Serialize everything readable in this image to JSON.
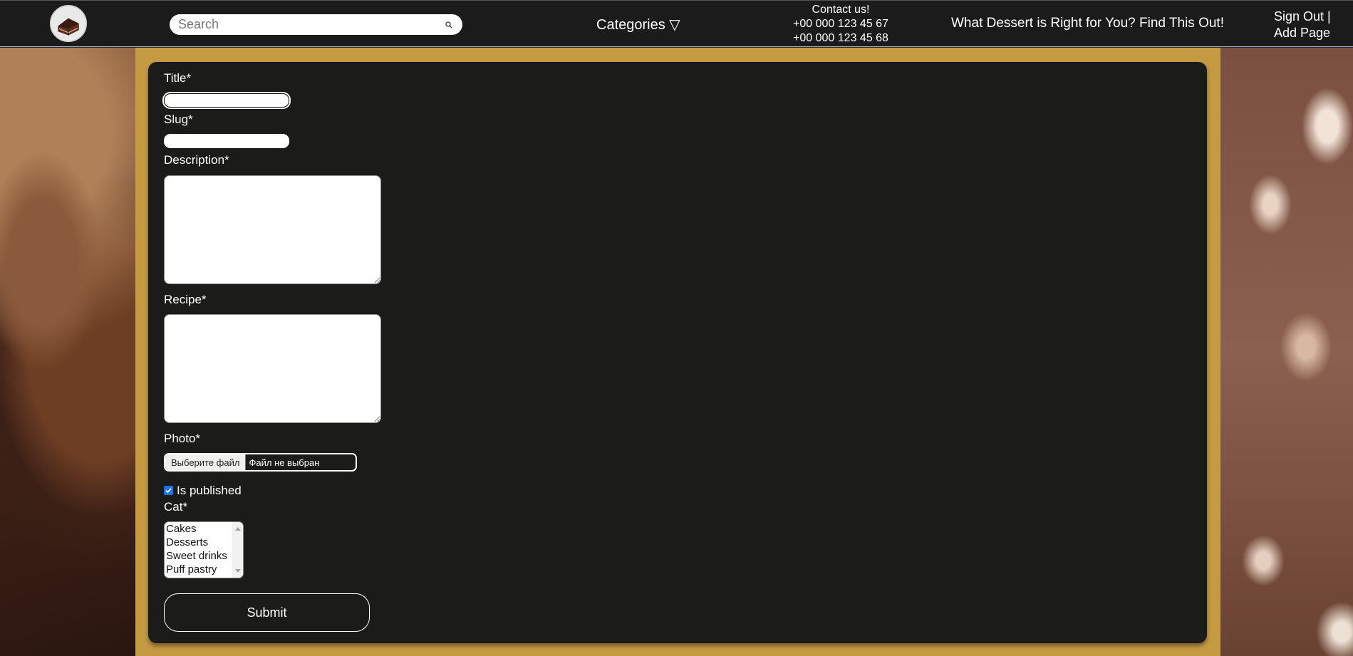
{
  "header": {
    "search_placeholder": "Search",
    "categories_label": "Categories ▽",
    "contact": {
      "title": "Contact us!",
      "phone1": "+00 000 123 45 67",
      "phone2": "+00 000 123 45 68"
    },
    "quiz_link": "What Dessert is Right for You? Find This Out!",
    "sign_out": "Sign Out |",
    "add_page": "Add Page"
  },
  "form": {
    "title_label": "Title*",
    "title_value": "",
    "slug_label": "Slug*",
    "slug_value": "",
    "description_label": "Description*",
    "description_value": "",
    "recipe_label": "Recipe*",
    "recipe_value": "",
    "photo_label": "Photo*",
    "photo_button": "Выберите файл",
    "photo_status": "Файл не выбран",
    "published_label": "Is published",
    "published_checked": true,
    "cat_label": "Cat*",
    "cat_options": [
      "Cakes",
      "Desserts",
      "Sweet drinks",
      "Puff pastry"
    ],
    "submit_label": "Submit"
  },
  "colors": {
    "header_bg": "#1b1b1b",
    "frame_gold": "#c49a43",
    "panel_bg": "#1b1c1a",
    "checkbox_blue": "#1a73e8"
  }
}
